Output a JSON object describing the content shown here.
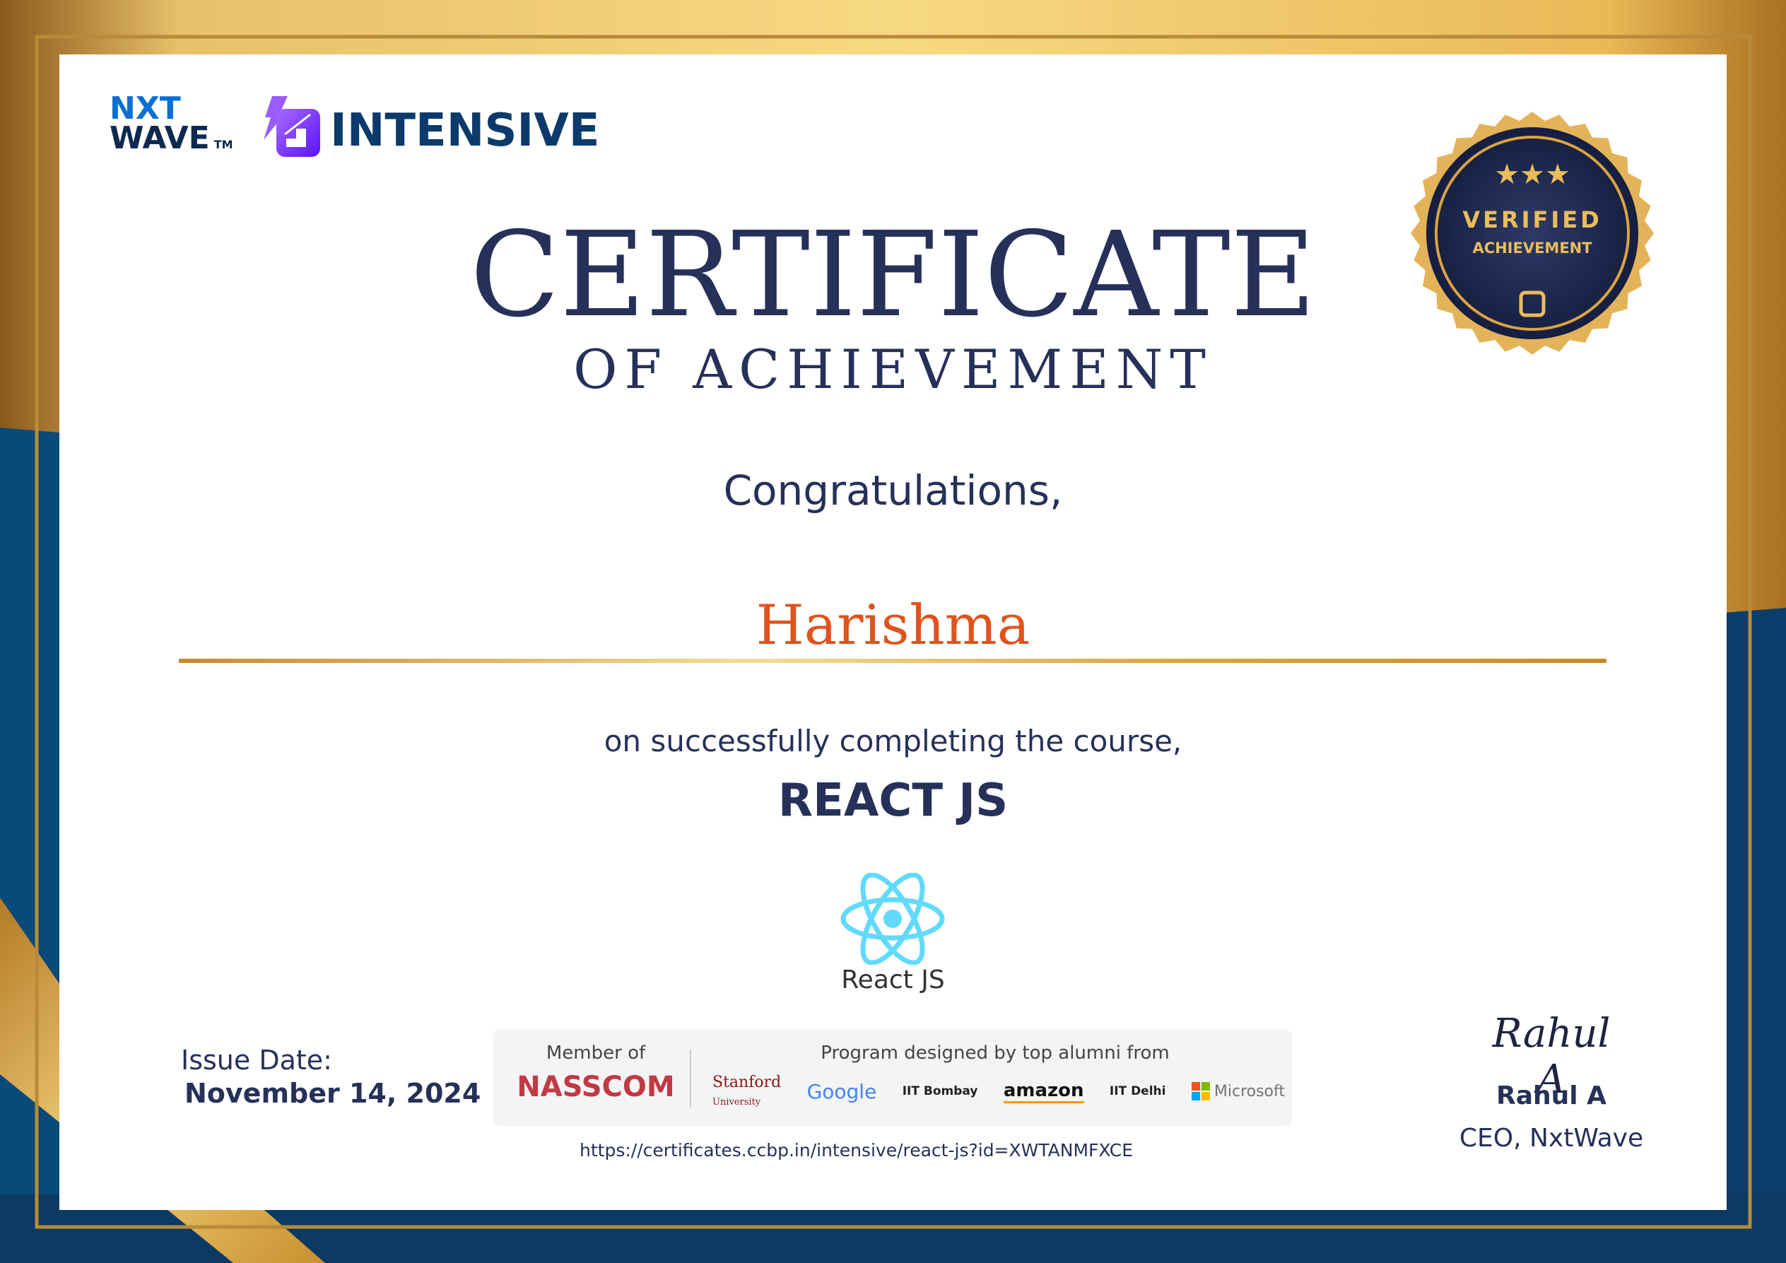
{
  "brand": {
    "nxtwave_line1": "NXT",
    "nxtwave_line2": "WAVE",
    "tm": "TM",
    "intensive": "INTENSIVE"
  },
  "badge": {
    "line1": "VERIFIED",
    "line2": "ACHIEVEMENT",
    "stars": 3
  },
  "title": {
    "main": "CERTIFICATE",
    "sub": "OF ACHIEVEMENT"
  },
  "greeting": "Congratulations,",
  "recipient": "Harishma",
  "completion_text": "on successfully completing the course,",
  "course": {
    "name": "REACT JS",
    "logo_label": "React JS"
  },
  "issue": {
    "label": "Issue Date:",
    "date": "November 14, 2024"
  },
  "partners": {
    "member_label": "Member of",
    "member": "NASSCOM",
    "designed_label": "Program designed by top alumni from",
    "stanford": "Stanford",
    "stanford_sub": "University",
    "google": "Google",
    "iitb": "IIT Bombay",
    "amazon": "amazon",
    "iitd": "IIT Delhi",
    "microsoft": "Microsoft"
  },
  "url": "https://certificates.ccbp.in/intensive/react-js?id=XWTANMFXCE",
  "signatory": {
    "signature": "Rahul A",
    "name": "Rahul A",
    "title": "CEO, NxtWave"
  },
  "colors": {
    "navy": "#26315a",
    "orange": "#e0531c",
    "gold": "#d9a441",
    "react": "#61dafb"
  }
}
